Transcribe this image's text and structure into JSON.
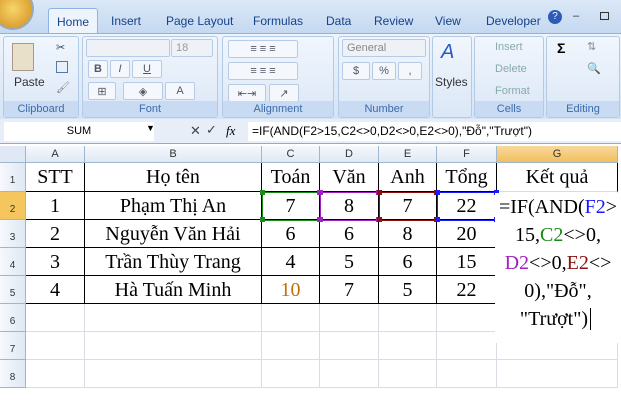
{
  "tabs": [
    "Home",
    "Insert",
    "Page Layout",
    "Formulas",
    "Data",
    "Review",
    "View",
    "Developer"
  ],
  "ribbon": {
    "font_size": "18",
    "number_format": "General",
    "groups": [
      "Clipboard",
      "Font",
      "Alignment",
      "Number",
      "Cells",
      "Editing"
    ],
    "paste": "Paste",
    "styles": "Styles",
    "insert": "Insert",
    "delete": "Delete",
    "format": "Format",
    "bold": "B",
    "italic": "I",
    "underline": "U",
    "sigma": "Σ",
    "dollar": "$",
    "percent": "%",
    "comma": ","
  },
  "formula_bar": {
    "name_box": "SUM",
    "fx": "fx",
    "formula": "=IF(AND(F2>15,C2<>0,D2<>0,E2<>0),\"Đỗ\",\"Trượt\")"
  },
  "columns": [
    "A",
    "B",
    "C",
    "D",
    "E",
    "F",
    "G"
  ],
  "rows": [
    "1",
    "2",
    "3",
    "4",
    "5",
    "6",
    "7",
    "8"
  ],
  "cells": [
    [
      "STT",
      "Họ tên",
      "Toán",
      "Văn",
      "Anh",
      "Tổng",
      "Kết quả"
    ],
    [
      "1",
      "Phạm Thị An",
      "7",
      "8",
      "7",
      "22",
      ""
    ],
    [
      "2",
      "Nguyễn Văn Hải",
      "6",
      "6",
      "8",
      "20",
      ""
    ],
    [
      "3",
      "Trần Thùy Trang",
      "4",
      "5",
      "6",
      "15",
      ""
    ],
    [
      "4",
      "Hà Tuấn Minh",
      "10",
      "7",
      "5",
      "22",
      ""
    ]
  ],
  "edit_lines": [
    [
      {
        "t": "=IF(AND(",
        "c": "#000"
      },
      {
        "t": "F2",
        "c": "#1a1aff"
      },
      {
        "t": ">",
        "c": "#000"
      }
    ],
    [
      {
        "t": "15,",
        "c": "#000"
      },
      {
        "t": "C2",
        "c": "#1a8a1a"
      },
      {
        "t": "<>0,",
        "c": "#000"
      }
    ],
    [
      {
        "t": "D2",
        "c": "#a020c0"
      },
      {
        "t": "<>0,",
        "c": "#000"
      },
      {
        "t": "E2",
        "c": "#8b1010"
      },
      {
        "t": "<>",
        "c": "#000"
      }
    ],
    [
      {
        "t": "0),\"Đỗ\",",
        "c": "#000"
      }
    ],
    [
      {
        "t": "\"Trượt\")",
        "c": "#000"
      }
    ]
  ],
  "ref_colors": {
    "C2": "#1a8a1a",
    "D2": "#a020c0",
    "E2": "#8b1010",
    "F2": "#1a1aff"
  }
}
